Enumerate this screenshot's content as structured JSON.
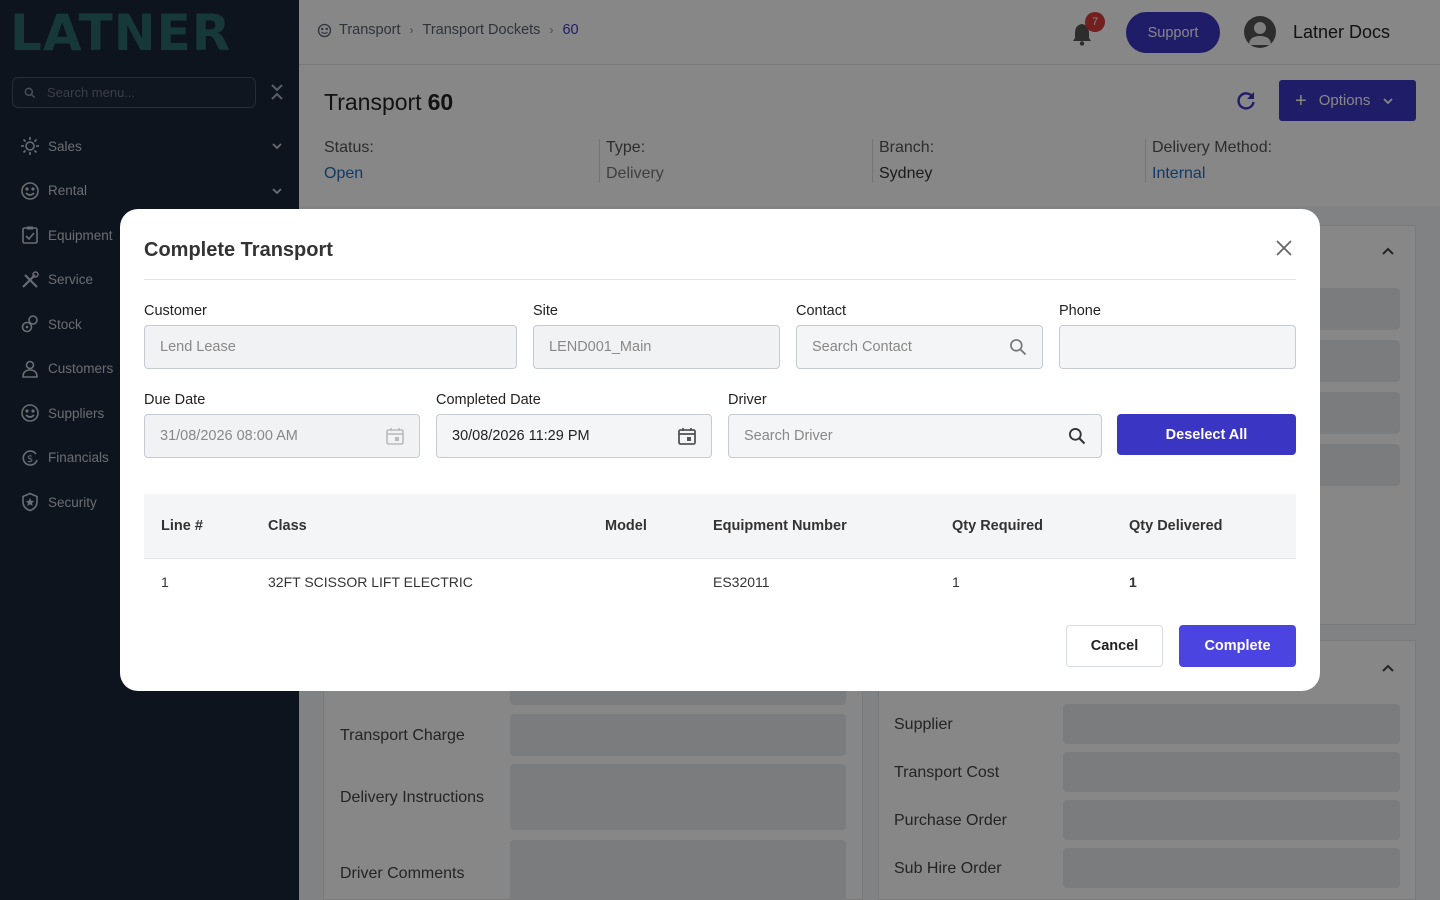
{
  "sidebar": {
    "logo": "LATNER",
    "search_placeholder": "Search menu...",
    "items": [
      {
        "label": "Sales",
        "icon": "sales-icon",
        "has_chevron": true
      },
      {
        "label": "Rental",
        "icon": "rental-icon",
        "has_chevron": true
      },
      {
        "label": "Equipment",
        "icon": "equipment-icon",
        "has_chevron": false
      },
      {
        "label": "Service",
        "icon": "service-icon",
        "has_chevron": false
      },
      {
        "label": "Stock",
        "icon": "stock-icon",
        "has_chevron": false
      },
      {
        "label": "Customers",
        "icon": "customers-icon",
        "has_chevron": false
      },
      {
        "label": "Suppliers",
        "icon": "suppliers-icon",
        "has_chevron": false
      },
      {
        "label": "Financials",
        "icon": "financials-icon",
        "has_chevron": false
      },
      {
        "label": "Security",
        "icon": "security-icon",
        "has_chevron": false
      }
    ]
  },
  "header": {
    "breadcrumb": [
      "Transport",
      "Transport Dockets",
      "60"
    ],
    "notification_count": "7",
    "support_label": "Support",
    "user_name": "Latner Docs"
  },
  "page": {
    "title_prefix": "Transport",
    "title_number": "60",
    "options_label": "Options",
    "info": [
      {
        "label": "Status:",
        "value": "Open",
        "color": "#1f6fc1"
      },
      {
        "label": "Type:",
        "value": "Delivery",
        "color": "#777777"
      },
      {
        "label": "Branch:",
        "value": "Sydney",
        "color": "#333333"
      },
      {
        "label": "Delivery Method:",
        "value": "Internal",
        "color": "#1f6fc1"
      }
    ],
    "left_card_rows": [
      "Transport Charge",
      "Delivery Instructions",
      "Driver Comments"
    ],
    "right_card_rows": [
      "Supplier",
      "Transport Cost",
      "Purchase Order",
      "Sub Hire Order"
    ]
  },
  "modal": {
    "title": "Complete Transport",
    "customer_label": "Customer",
    "customer_value": "Lend Lease",
    "site_label": "Site",
    "site_value": "LEND001_Main",
    "contact_label": "Contact",
    "contact_placeholder": "Search Contact",
    "phone_label": "Phone",
    "phone_value": "",
    "due_date_label": "Due Date",
    "due_date_value": "31/08/2026 08:00 AM",
    "completed_date_label": "Completed Date",
    "completed_date_value": "30/08/2026 11:29 PM",
    "driver_label": "Driver",
    "driver_placeholder": "Search Driver",
    "deselect_label": "Deselect All",
    "table": {
      "headers": [
        "Line #",
        "Class",
        "Model",
        "Equipment Number",
        "Qty Required",
        "Qty Delivered"
      ],
      "rows": [
        [
          "1",
          "32FT SCISSOR LIFT ELECTRIC",
          "",
          "ES32011",
          "1",
          "1"
        ]
      ]
    },
    "cancel_label": "Cancel",
    "complete_label": "Complete"
  },
  "colors": {
    "primary": "#3b35c4",
    "sidebar_bg": "#1b2638",
    "link": "#1f6fc1"
  }
}
